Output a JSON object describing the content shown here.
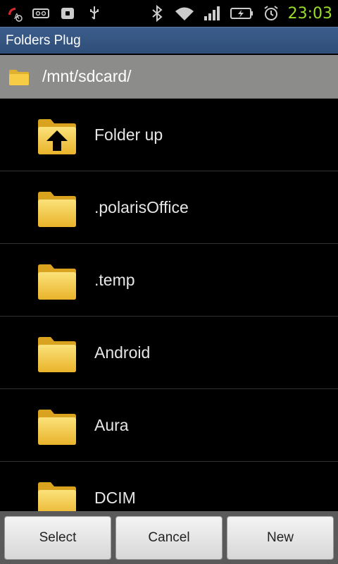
{
  "status_bar": {
    "time": "23:03",
    "icons": [
      "missed-call-icon",
      "voicemail-icon",
      "lock-icon",
      "usb-icon",
      "bluetooth-icon",
      "wifi-icon",
      "signal-icon",
      "battery-charging-icon",
      "alarm-icon"
    ]
  },
  "title_bar": {
    "title": "Folders Plug"
  },
  "path_bar": {
    "path": "/mnt/sdcard/"
  },
  "list": {
    "items": [
      {
        "label": "Folder up",
        "icon": "folder-up-icon"
      },
      {
        "label": ".polarisOffice",
        "icon": "folder-icon"
      },
      {
        "label": ".temp",
        "icon": "folder-icon"
      },
      {
        "label": "Android",
        "icon": "folder-icon"
      },
      {
        "label": "Aura",
        "icon": "folder-icon"
      },
      {
        "label": "DCIM",
        "icon": "folder-icon"
      }
    ]
  },
  "buttons": {
    "select": "Select",
    "cancel": "Cancel",
    "new": "New"
  },
  "colors": {
    "title_bar": "#2f4e78",
    "path_bar": "#8c8c8a",
    "folder": "#f2c23a",
    "clock": "#9bdc2a"
  }
}
